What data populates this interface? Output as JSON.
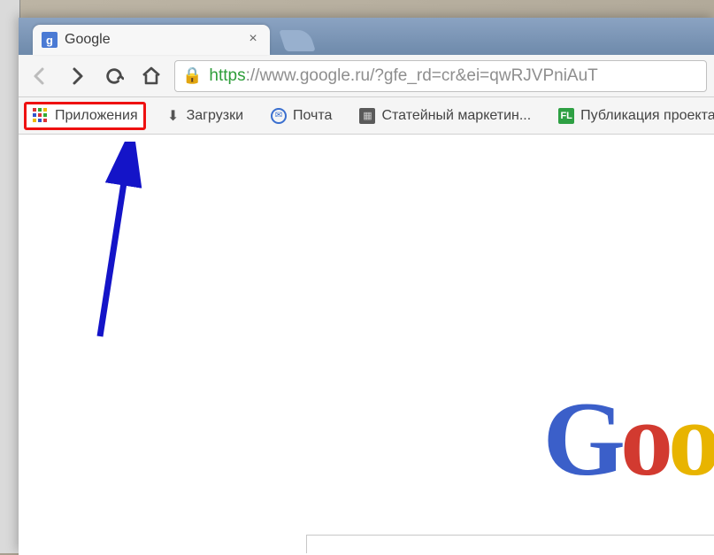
{
  "tab": {
    "title": "Google",
    "favicon_letter": "g"
  },
  "address_bar": {
    "scheme": "https",
    "rest": "://www.google.ru/?gfe_rd=cr&ei=qwRJVPniAuT"
  },
  "bookmarks": {
    "apps": {
      "label": "Приложения"
    },
    "downloads": {
      "label": "Загрузки"
    },
    "mail": {
      "label": "Почта"
    },
    "statmkt": {
      "label": "Статейный маркетин..."
    },
    "flpub": {
      "label": "Публикация проекта..."
    }
  },
  "logo": {
    "g": "G",
    "o1": "o",
    "o2": "o"
  }
}
